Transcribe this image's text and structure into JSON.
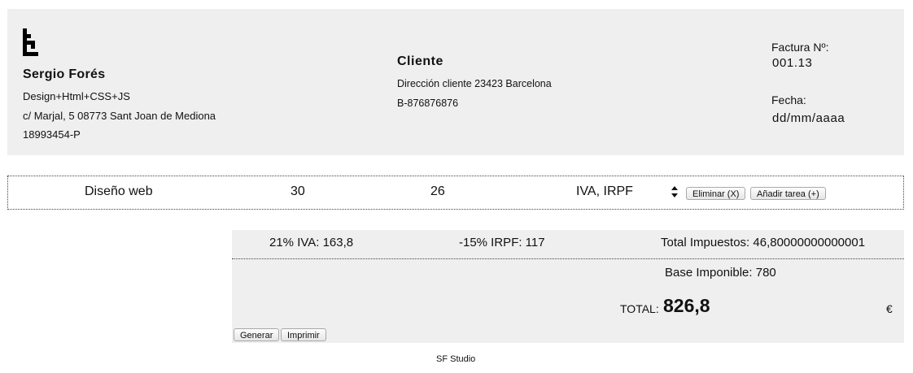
{
  "sender": {
    "name": "Sergio Forés",
    "role": "Design+Html+CSS+JS",
    "address": "c/ Marjal, 5 08773 Sant Joan de Mediona",
    "id": "18993454-P"
  },
  "client": {
    "title": "Cliente",
    "address": "Dirección cliente 23423 Barcelona",
    "id": "B-876876876"
  },
  "invoice": {
    "number_label": "Factura Nº:",
    "number": "001.13",
    "date_label": "Fecha:",
    "date": "dd/mm/aaaa"
  },
  "task": {
    "description": "Diseño web",
    "hours": "30",
    "rate": "26",
    "taxes": "IVA, IRPF",
    "delete_label": "Eliminar (X)",
    "add_label": "Añadir tarea (+)"
  },
  "totals": {
    "iva": "21% IVA: 163,8",
    "irpf": "-15% IRPF: 117",
    "total_taxes": "Total Impuestos: 46,80000000000001",
    "base": "Base Imponible: 780",
    "total_label": "TOTAL:",
    "total_value": "826,8",
    "currency": "€",
    "generate_label": "Generar",
    "print_label": "Imprimir"
  },
  "footer": {
    "text": "SF Studio"
  }
}
